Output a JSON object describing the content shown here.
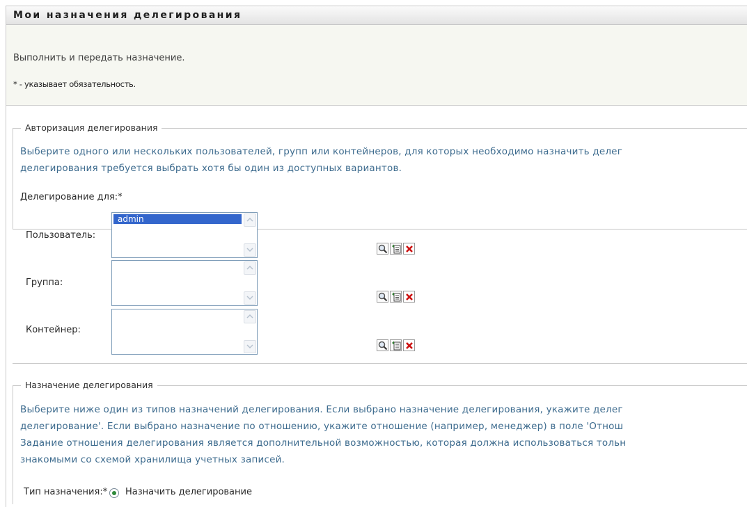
{
  "header": {
    "title": "Мои назначения делегирования"
  },
  "intro": {
    "description": "Выполнить и передать назначение.",
    "required_note": "* - указывает обязательность."
  },
  "authorization": {
    "legend": "Авторизация делегирования",
    "help_line1": "Выберите одного или нескольких пользователей, групп или контейнеров, для которых необходимо назначить делег",
    "help_line2": "делегирования требуется выбрать хотя бы один из доступных вариантов.",
    "delegate_for_label": "Делегирование для:*",
    "user_label": "Пользователь:",
    "user_items": [
      "admin"
    ],
    "group_label": "Группа:",
    "container_label": "Контейнер:"
  },
  "assignment": {
    "legend": "Назначение делегирования",
    "help_line1": "Выберите ниже один из типов назначений делегирования. Если выбрано назначение делегирования, укажите делег",
    "help_line2": "делегирование'. Если выбрано назначение по отношению, укажите отношение (например, менеджер) в поле 'Отнош",
    "help_line3": "Задание отношения делегирования является дополнительной возможностью, которая должна использоваться тольн",
    "help_line4": "знакомыми со схемой хранилища учетных записей.",
    "type_label": "Тип назначения:*",
    "type_option": "Назначить делегирование"
  },
  "icons": {
    "lookup": "magnifier-icon",
    "history": "history-list-icon",
    "clear": "red-x-icon"
  },
  "colors": {
    "help_text": "#3d6b8e",
    "selection": "#3366cc",
    "clear": "#cc1111"
  }
}
